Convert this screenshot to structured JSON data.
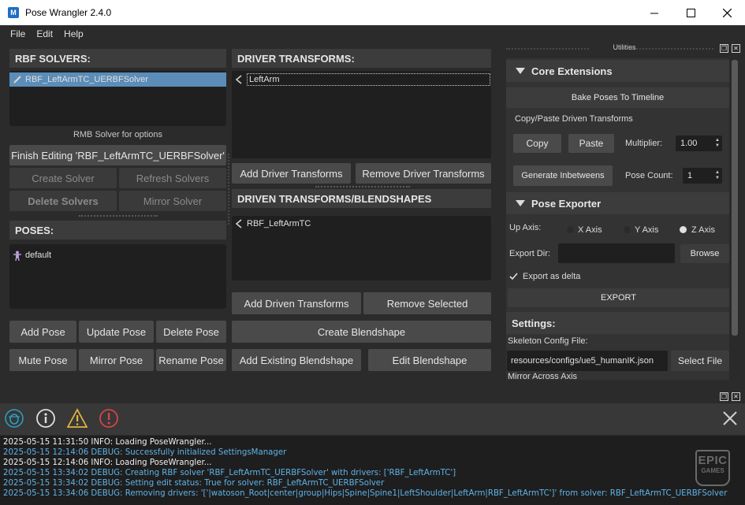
{
  "window": {
    "title": "Pose Wrangler 2.4.0",
    "icon_letter": "M"
  },
  "menu": [
    "File",
    "Edit",
    "Help"
  ],
  "rbf": {
    "header": "RBF SOLVERS:",
    "solvers": [
      "RBF_LeftArmTC_UERBFSolver"
    ],
    "hint": "RMB Solver for options",
    "finish_editing": "Finish Editing 'RBF_LeftArmTC_UERBFSolver'",
    "create_solver": "Create Solver",
    "refresh_solvers": "Refresh Solvers",
    "delete_solvers": "Delete Solvers",
    "mirror_solver": "Mirror Solver"
  },
  "poses": {
    "header": "POSES:",
    "items": [
      "default"
    ],
    "add_pose": "Add Pose",
    "update_pose": "Update Pose",
    "delete_pose": "Delete Pose",
    "mute_pose": "Mute Pose",
    "mirror_pose": "Mirror Pose",
    "rename_pose": "Rename Pose"
  },
  "driver": {
    "header": "DRIVER TRANSFORMS:",
    "items": [
      "LeftArm"
    ],
    "add": "Add Driver Transforms",
    "remove": "Remove Driver Transforms"
  },
  "driven": {
    "header": "DRIVEN TRANSFORMS/BLENDSHAPES",
    "items": [
      "RBF_LeftArmTC"
    ],
    "add": "Add Driven Transforms",
    "remove": "Remove Selected",
    "create_blendshape": "Create Blendshape",
    "add_existing": "Add Existing Blendshape",
    "edit_blendshape": "Edit Blendshape"
  },
  "utilities": {
    "title": "Utilities",
    "core": {
      "header": "Core Extensions",
      "bake": "Bake Poses To Timeline",
      "copy_paste_label": "Copy/Paste Driven Transforms",
      "copy": "Copy",
      "paste": "Paste",
      "multiplier_label": "Multiplier:",
      "multiplier_value": "1.00",
      "generate": "Generate Inbetweens",
      "pose_count_label": "Pose Count:",
      "pose_count_value": "1"
    },
    "exporter": {
      "header": "Pose Exporter",
      "up_axis_label": "Up Axis:",
      "axes": [
        "X Axis",
        "Y Axis",
        "Z Axis"
      ],
      "selected_axis": "Z Axis",
      "export_dir_label": "Export Dir:",
      "export_dir_value": "",
      "browse": "Browse",
      "export_as_delta": "Export as delta",
      "export_as_delta_checked": true,
      "export": "EXPORT"
    },
    "settings": {
      "header": "Settings:",
      "skeleton_label": "Skeleton Config File:",
      "skeleton_value": "resources/configs/ue5_humanIK.json",
      "select_file": "Select File",
      "mirror_axis_label": "Mirror Across Axis"
    }
  },
  "log": {
    "lines": [
      {
        "level": "info",
        "text": "2025-05-15 11:31:50 INFO: Loading PoseWrangler..."
      },
      {
        "level": "debug",
        "text": "2025-05-15 12:14:06 DEBUG: Successfully initialized SettingsManager"
      },
      {
        "level": "info",
        "text": "2025-05-15 12:14:06 INFO: Loading PoseWrangler..."
      },
      {
        "level": "debug",
        "text": "2025-05-15 13:34:02 DEBUG: Creating RBF solver 'RBF_LeftArmTC_UERBFSolver' with drivers: ['RBF_LeftArmTC']"
      },
      {
        "level": "debug",
        "text": "2025-05-15 13:34:02 DEBUG: Setting edit status: True for solver: RBF_LeftArmTC_UERBFSolver"
      },
      {
        "level": "debug",
        "text": "2025-05-15 13:34:06 DEBUG: Removing drivers: '['|watoson_Root|center|group|Hips|Spine|Spine1|LeftShoulder|LeftArm|RBF_LeftArmTC']' from solver: RBF_LeftArmTC_UERBFSolver"
      }
    ],
    "logo_top": "EPIC",
    "logo_bottom": "GAMES"
  }
}
